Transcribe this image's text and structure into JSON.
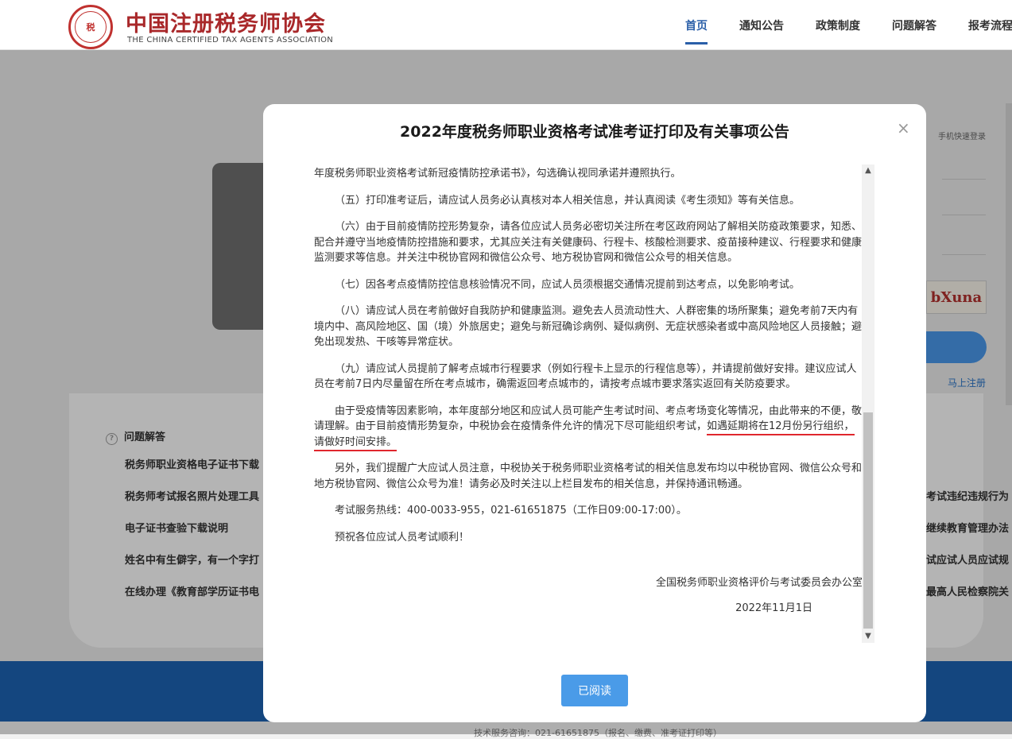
{
  "header": {
    "logo_cn": "中国注册税务师协会",
    "logo_en": "THE CHINA CERTIFIED TAX AGENTS ASSOCIATION",
    "seal_text": "税",
    "nav": [
      "首页",
      "通知公告",
      "政策制度",
      "问题解答",
      "报考流程"
    ]
  },
  "background": {
    "phone_login": "手机快速登录",
    "captcha": "bXuna",
    "register": "马上注册",
    "qa_title": "问题解答",
    "left_items": [
      "税务师职业资格电子证书下载",
      "税务师考试报名照片处理工具",
      "电子证书查验下载说明",
      "姓名中有生僻字，有一个字打",
      "在线办理《教育部学历证书电"
    ],
    "right_items": [
      "考试违纪违规行为",
      "继续教育管理办法",
      "试应试人员应试规",
      "最高人民检察院关"
    ],
    "footer": "技术服务咨询：021-61651875（报名、缴费、准考证打印等）"
  },
  "modal": {
    "title": "2022年度税务师职业资格考试准考证打印及有关事项公告",
    "close": "×",
    "paragraphs": {
      "p0": "年度税务师职业资格考试新冠疫情防控承诺书》，勾选确认视同承诺并遵照执行。",
      "p5": "（五）打印准考证后，请应试人员务必认真核对本人相关信息，并认真阅读《考生须知》等有关信息。",
      "p6": "（六）由于目前疫情防控形势复杂，请各位应试人员务必密切关注所在考区政府网站了解相关防疫政策要求，知悉、配合并遵守当地疫情防控措施和要求，尤其应关注有关健康码、行程卡、核酸检测要求、疫苗接种建议、行程要求和健康监测要求等信息。并关注中税协官网和微信公众号、地方税协官网和微信公众号的相关信息。",
      "p7": "（七）因各考点疫情防控信息核验情况不同，应试人员须根据交通情况提前到达考点，以免影响考试。",
      "p8": "（八）请应试人员在考前做好自我防护和健康监测。避免去人员流动性大、人群密集的场所聚集；避免考前7天内有境内中、高风险地区、国（境）外旅居史；避免与新冠确诊病例、疑似病例、无症状感染者或中高风险地区人员接触；避免出现发热、干咳等异常症状。",
      "p9": "（九）请应试人员提前了解考点城市行程要求（例如行程卡上显示的行程信息等），并请提前做好安排。建议应试人员在考前7日内尽量留在所在考点城市，确需返回考点城市的，请按考点城市要求落实返回有关防疫要求。",
      "p10_a": "由于受疫情等因素影响，本年度部分地区和应试人员可能产生考试时间、考点考场变化等情况，由此带来的不便，敬请理解。由于目前疫情形势复杂，中税协会在疫情条件允许的情况下尽可能组织考试，",
      "p10_b": "如遇延期将在12月份另行组织，请做好时间安排。",
      "p11": "另外，我们提醒广大应试人员注意，中税协关于税务师职业资格考试的相关信息发布均以中税协官网、微信公众号和地方税协官网、微信公众号为准！请务必及时关注以上栏目发布的相关信息，并保持通讯畅通。",
      "p12": "考试服务热线：400-0033-955，021-61651875（工作日09:00-17:00）。",
      "p13": "预祝各位应试人员考试顺利！"
    },
    "signature": "全国税务师职业资格评价与考试委员会办公室",
    "date": "2022年11月1日",
    "button": "已阅读"
  },
  "colors": {
    "brand_red": "#a9282a",
    "nav_active": "#2a5fa8",
    "button_blue": "#4a9be8",
    "underline_red": "#e0262d"
  }
}
